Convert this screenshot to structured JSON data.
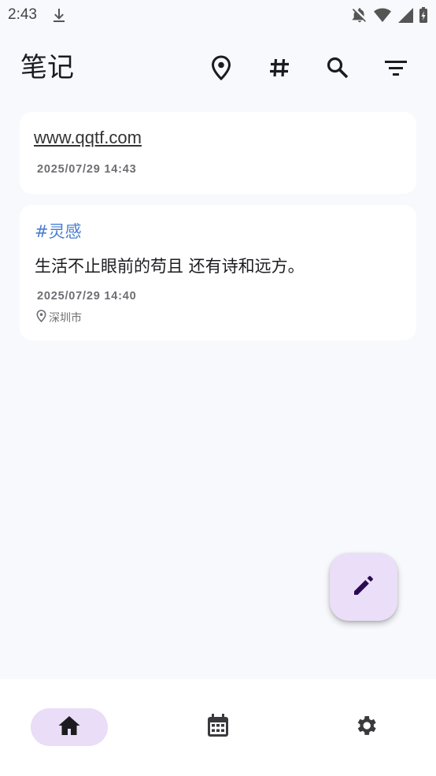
{
  "status_bar": {
    "time": "2:43",
    "icons": [
      "download-icon",
      "notifications-off-icon",
      "wifi-icon",
      "cellular-signal-icon",
      "battery-charging-icon"
    ]
  },
  "app_bar": {
    "title": "笔记",
    "actions": [
      "location-pin-icon",
      "hashtag-icon",
      "search-icon",
      "filter-icon"
    ]
  },
  "notes": [
    {
      "link": "www.qqtf.com",
      "time": "2025/07/29 14:43"
    },
    {
      "tag": "#灵感",
      "content": "生活不止眼前的苟且 还有诗和远方。",
      "time": "2025/07/29 14:40",
      "location": "深圳市"
    }
  ],
  "fab": {
    "icon": "edit-pencil-icon"
  },
  "bottom_nav": {
    "items": [
      {
        "icon": "home-icon",
        "selected": true
      },
      {
        "icon": "calendar-icon",
        "selected": false
      },
      {
        "icon": "settings-gear-icon",
        "selected": false
      }
    ]
  },
  "colors": {
    "background": "#f8f9fc",
    "card": "#ffffff",
    "tag": "#4a7fd0",
    "fab": "#ebdef8",
    "nav_indicator": "#e9ddf7",
    "fab_icon": "#2b0a52"
  }
}
